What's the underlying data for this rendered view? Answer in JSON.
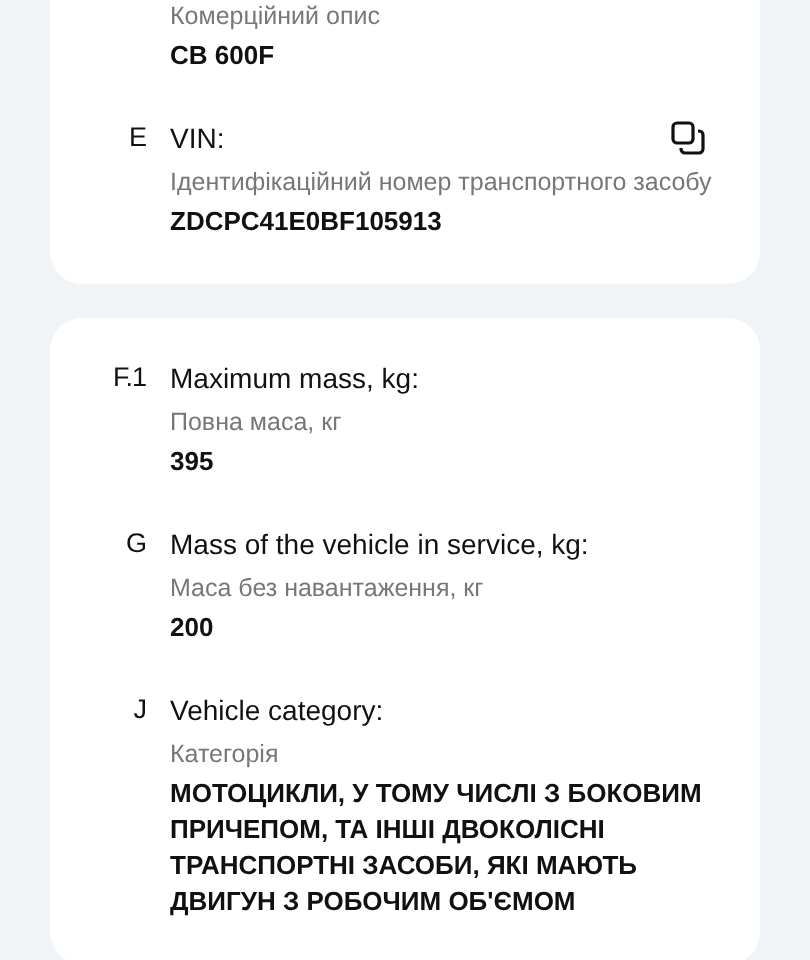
{
  "cards": [
    {
      "fields": [
        {
          "subtitle": "Комерційний опис",
          "value": "CB 600F",
          "copyable": false
        },
        {
          "code": "E",
          "label": "VIN:",
          "subtitle": "Ідентифікаційний номер транспортного засобу",
          "value": "ZDCPC41E0BF105913",
          "copyable": true
        }
      ]
    },
    {
      "fields": [
        {
          "code": "F.1",
          "label": "Maximum mass, kg:",
          "subtitle": "Повна маса, кг",
          "value": "395",
          "copyable": false
        },
        {
          "code": "G",
          "label": "Mass of the vehicle in service, kg:",
          "subtitle": "Маса без навантаження, кг",
          "value": "200",
          "copyable": false
        },
        {
          "code": "J",
          "label": "Vehicle category:",
          "subtitle": "Категорія",
          "value": "МОТОЦИКЛИ, У ТОМУ ЧИСЛІ З БОКОВИМ ПРИЧЕПОМ, ТА ІНШІ ДВОКОЛІСНІ ТРАНСПОРТНІ ЗАСОБИ, ЯКІ МАЮТЬ ДВИГУН З РОБОЧИМ ОБ'ЄМОМ",
          "copyable": false
        }
      ]
    }
  ]
}
